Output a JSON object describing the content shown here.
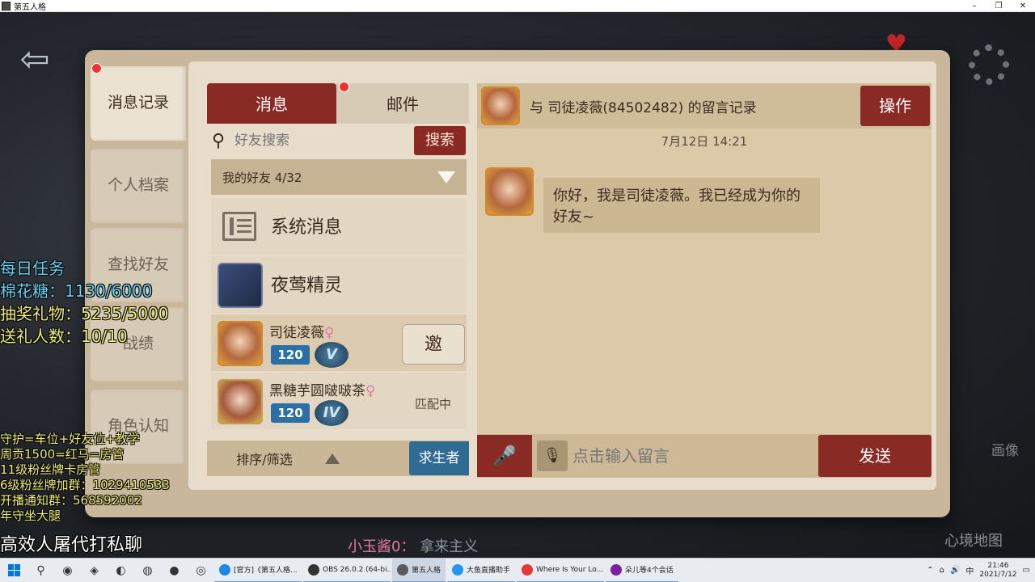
{
  "window": {
    "title": "第五人格",
    "minimize": "–",
    "maximize": "❐",
    "close": "✕"
  },
  "left_tabs": [
    "消息记录",
    "个人档案",
    "查找好友",
    "战绩",
    "角色认知"
  ],
  "tabs": {
    "messages": "消息",
    "mail": "邮件"
  },
  "search": {
    "placeholder": "好友搜索",
    "button": "搜索"
  },
  "friends_dropdown": "我的好友 4/32",
  "list": {
    "system": "系统消息",
    "nightingale": "夜莺精灵",
    "friends": [
      {
        "name": "司徒凌薇",
        "gender": "♀",
        "level": "120",
        "rank": "V",
        "action": "邀"
      },
      {
        "name": "黑糖芋圆啵啵茶",
        "gender": "♀",
        "level": "120",
        "rank": "IV",
        "status": "匹配中"
      }
    ]
  },
  "bottom_bar": {
    "sort": "排序/筛选",
    "role": "求生者"
  },
  "chat": {
    "header": "与 司徒凌薇(84502482) 的留言记录",
    "operate": "操作",
    "timestamp": "7月12日 14:21",
    "message": "你好，我是司徒凌薇。我已经成为你的好友~",
    "input_placeholder": "点击输入留言",
    "send": "发送"
  },
  "overlay": {
    "daily": "每日任务",
    "marshmallow_label": "棉花糖：",
    "marshmallow": "1130/6000",
    "lottery_label": "抽奖礼物：",
    "lottery": "5235/5000",
    "givers_label": "送礼人数：",
    "givers": "10/10",
    "rules": [
      "守护=车位+好友位+教学",
      "周贡1500=红马=房管",
      "11级粉丝牌卡房管",
      "6级粉丝牌加群：1029410533",
      "开播通知群：568592002",
      "年守坐大腿"
    ],
    "big": "高效人屠代打私聊",
    "danmaku_user": "小玉酱0：",
    "danmaku_text": "拿来主义"
  },
  "map_label": "心境地图",
  "side_text": "画像",
  "taskbar": {
    "apps": [
      {
        "label": "[官方]《第五人格...",
        "color": "#1e88e5"
      },
      {
        "label": "OBS 26.0.2 (64-bi...",
        "color": "#333333"
      },
      {
        "label": "第五人格",
        "color": "#5a5a5a"
      },
      {
        "label": "大鱼直播助手",
        "color": "#2196f3"
      },
      {
        "label": "Where Is Your Lo...",
        "color": "#e53935"
      },
      {
        "label": "朵儿等4个会话",
        "color": "#7b1fa2"
      }
    ],
    "ime": "中",
    "time": "21:46",
    "date": "2021/7/12"
  },
  "colors": {
    "accent_red": "#8a2a25",
    "paper": "#e8dccb",
    "role_blue": "#2f6b93"
  }
}
